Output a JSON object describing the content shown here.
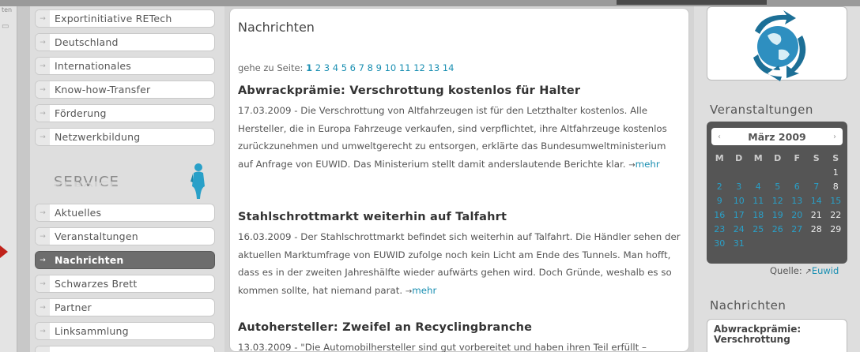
{
  "left_menu": {
    "top_items": [
      {
        "label": "Exportinitiative RETech"
      },
      {
        "label": "Deutschland"
      },
      {
        "label": "Internationales"
      },
      {
        "label": "Know-how-Transfer"
      },
      {
        "label": "Förderung"
      },
      {
        "label": "Netzwerkbildung"
      }
    ],
    "service_heading": "SERVICE",
    "service_items": [
      {
        "label": "Aktuelles"
      },
      {
        "label": "Veranstaltungen"
      },
      {
        "label": "Nachrichten",
        "active": true
      },
      {
        "label": "Schwarzes Brett"
      },
      {
        "label": "Partner"
      },
      {
        "label": "Linksammlung"
      }
    ]
  },
  "main": {
    "title": "Nachrichten",
    "pager_label": "gehe zu Seite:",
    "pages": [
      "1",
      "2",
      "3",
      "4",
      "5",
      "6",
      "7",
      "8",
      "9",
      "10",
      "11",
      "12",
      "13",
      "14"
    ],
    "articles": [
      {
        "title": "Abwrackprämie: Verschrottung kostenlos für Halter",
        "body": "17.03.2009 - Die Verschrottung von Altfahrzeugen ist für den Letzthalter kostenlos. Alle Hersteller, die in Europa Fahrzeuge verkaufen, sind verpflichtet, ihre Altfahrzeuge kostenlos zurückzunehmen und umweltgerecht zu entsorgen, erklärte das Bundesumweltministerium auf Anfrage von EUWID. Das Ministerium stellt damit anderslautende Berichte klar.",
        "more": "mehr"
      },
      {
        "title": "Stahlschrottmarkt weiterhin auf Talfahrt",
        "body": "16.03.2009 - Der Stahlschrottmarkt befindet sich weiterhin auf Talfahrt. Die Händler sehen der aktuellen Marktumfrage von EUWID zufolge noch kein Licht am Ende des Tunnels. Man hofft, dass es in der zweiten Jahreshälfte wieder aufwärts gehen wird. Doch Gründe, weshalb es so kommen sollte, hat niemand parat.",
        "more": "mehr"
      },
      {
        "title": "Autohersteller: Zweifel an Recyclingbranche",
        "body": "13.03.2009 - \"Die Automobilhersteller sind gut vorbereitet und haben ihren Teil erfüllt –",
        "more": ""
      }
    ]
  },
  "right": {
    "events_title": "Veranstaltungen",
    "calendar": {
      "month": "März 2009",
      "prev": "‹",
      "next": "›",
      "weekdays": [
        "M",
        "D",
        "M",
        "D",
        "F",
        "S",
        "S"
      ],
      "rows": [
        [
          "",
          "",
          "",
          "",
          "",
          "",
          "1"
        ],
        [
          "2",
          "3",
          "4",
          "5",
          "6",
          "7",
          "8"
        ],
        [
          "9",
          "10",
          "11",
          "12",
          "13",
          "14",
          "15"
        ],
        [
          "16",
          "17",
          "18",
          "19",
          "20",
          "21",
          "22"
        ],
        [
          "23",
          "24",
          "25",
          "26",
          "27",
          "28",
          "29"
        ],
        [
          "30",
          "31",
          "",
          "",
          "",
          "",
          ""
        ]
      ],
      "event_days": [
        "2",
        "3",
        "4",
        "5",
        "6",
        "7",
        "9",
        "10",
        "11",
        "12",
        "13",
        "14",
        "15",
        "16",
        "17",
        "18",
        "19",
        "20",
        "23",
        "24",
        "25",
        "26",
        "27",
        "30",
        "31"
      ]
    },
    "source_label": "Quelle:",
    "source_link": "Euwid",
    "news_title": "Nachrichten",
    "news_box_text": "Abwrackprämie: Verschrottung"
  },
  "colors": {
    "link": "#1a8fb2",
    "active_menu": "#6d6d6d",
    "calendar_bg": "#555555",
    "marker": "#c0221a"
  }
}
